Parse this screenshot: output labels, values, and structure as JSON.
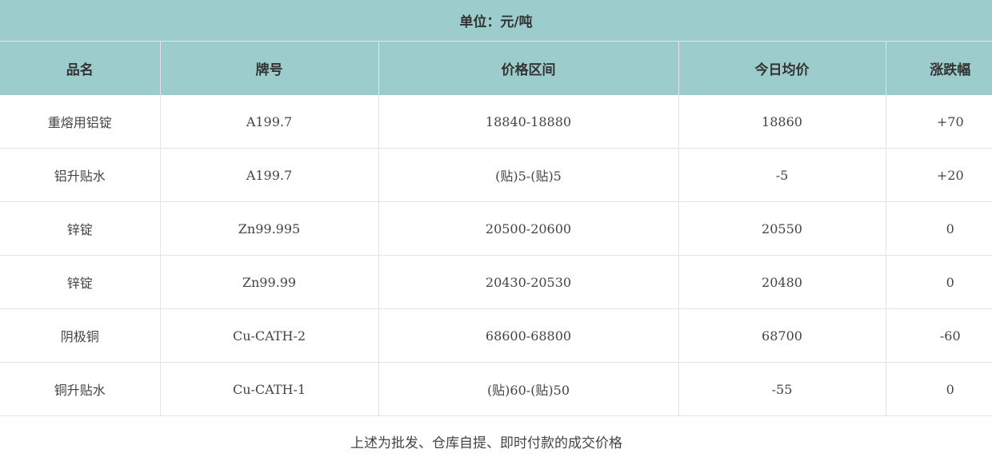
{
  "unit_label": "单位：元/吨",
  "columns": [
    "品名",
    "牌号",
    "价格区间",
    "今日均价",
    "涨跌幅"
  ],
  "rows": [
    [
      "重熔用铝锭",
      "A199.7",
      "18840-18880",
      "18860",
      "+70"
    ],
    [
      "铝升贴水",
      "A199.7",
      "(贴)5-(贴)5",
      "-5",
      "+20"
    ],
    [
      "锌锭",
      "Zn99.995",
      "20500-20600",
      "20550",
      "0"
    ],
    [
      "锌锭",
      "Zn99.99",
      "20430-20530",
      "20480",
      "0"
    ],
    [
      "阴极铜",
      "Cu-CATH-2",
      "68600-68800",
      "68700",
      "-60"
    ],
    [
      "铜升贴水",
      "Cu-CATH-1",
      "(贴)60-(贴)50",
      "-55",
      "0"
    ]
  ],
  "footer_note": "上述为批发、仓库自提、即时付款的成交价格",
  "colors": {
    "header_bg": "#9ccccc",
    "border": "#e3e3e3"
  }
}
